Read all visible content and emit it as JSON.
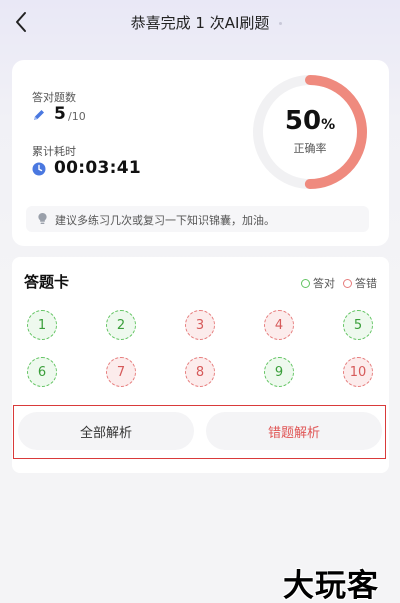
{
  "header": {
    "title": "恭喜完成 1 次AI刷题"
  },
  "result": {
    "count_label": "答对题数",
    "count_value": "5",
    "count_total": "/10",
    "time_label": "累计耗时",
    "time_value": "00:03:41",
    "accuracy_value": "50",
    "accuracy_unit": "%",
    "accuracy_fraction": 0.5,
    "accuracy_label": "正确率",
    "tip": "建议多练习几次或复习一下知识锦囊，加油。"
  },
  "answer_card": {
    "title": "答题卡",
    "legend_correct": "答对",
    "legend_wrong": "答错",
    "questions": [
      {
        "n": "1",
        "status": "correct"
      },
      {
        "n": "2",
        "status": "correct"
      },
      {
        "n": "3",
        "status": "wrong"
      },
      {
        "n": "4",
        "status": "wrong"
      },
      {
        "n": "5",
        "status": "correct"
      },
      {
        "n": "6",
        "status": "correct"
      },
      {
        "n": "7",
        "status": "wrong"
      },
      {
        "n": "8",
        "status": "wrong"
      },
      {
        "n": "9",
        "status": "correct"
      },
      {
        "n": "10",
        "status": "wrong"
      }
    ],
    "all_analysis": "全部解析",
    "wrong_analysis": "错题解析"
  },
  "colors": {
    "ring_fill": "#ef8a7e",
    "ring_track": "#f1f1f3",
    "correct": "#62c462",
    "wrong": "#e67c7c",
    "highlight_frame": "#d93a3a"
  },
  "icons": {
    "back": "chevron-left-icon",
    "count": "pencil-icon",
    "time": "clock-icon",
    "tip": "bulb-icon"
  },
  "watermark": "大玩客"
}
